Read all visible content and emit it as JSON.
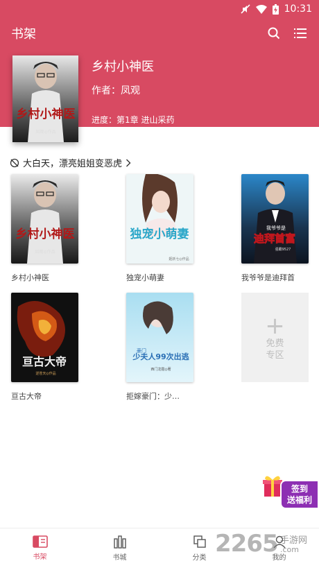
{
  "status_bar": {
    "time": "10:31"
  },
  "app_bar": {
    "title": "书架"
  },
  "current_book": {
    "title": "乡村小神医",
    "author": "作者：凤观",
    "progress": "进度：第1章 进山采药",
    "cover_text": "乡村小神医",
    "cover_credit": "凤观◎作品"
  },
  "notice": {
    "text": "大白天，漂亮姐姐变恶虎"
  },
  "books": [
    {
      "name": "乡村小神医",
      "cover_text": "乡村小神医",
      "cover_credit": "凤观◎作品"
    },
    {
      "name": "独宠小萌妻",
      "cover_text": "独宠小萌妻",
      "cover_credit": "姬妖七◎作品"
    },
    {
      "name": "我爷爷是迪拜首",
      "cover_text": "迪拜首富",
      "cover_top": "我爷爷是",
      "cover_credit": "强霸9527"
    },
    {
      "name": "亘古大帝",
      "cover_text": "亘古大帝",
      "cover_credit": "逆苍天◎作品"
    },
    {
      "name": "拒嫁豪门：少…",
      "cover_text": "少夫人99次出逃",
      "cover_top": "豪门",
      "cover_credit": "西门龙霆◎著"
    }
  ],
  "add_slot": {
    "line1": "免费",
    "line2": "专区"
  },
  "signin": {
    "line1": "签到",
    "line2": "送福利"
  },
  "nav": [
    {
      "label": "书架",
      "icon": "bookshelf-icon",
      "active": true
    },
    {
      "label": "书城",
      "icon": "bookstore-icon",
      "active": false
    },
    {
      "label": "分类",
      "icon": "category-icon",
      "active": false
    },
    {
      "label": "我的",
      "icon": "profile-icon",
      "active": false
    }
  ],
  "watermark": {
    "number": "2265",
    "site": "手游网",
    "url": ".com"
  },
  "colors": {
    "primary": "#d84a62",
    "signin": "#8d2fb3"
  }
}
